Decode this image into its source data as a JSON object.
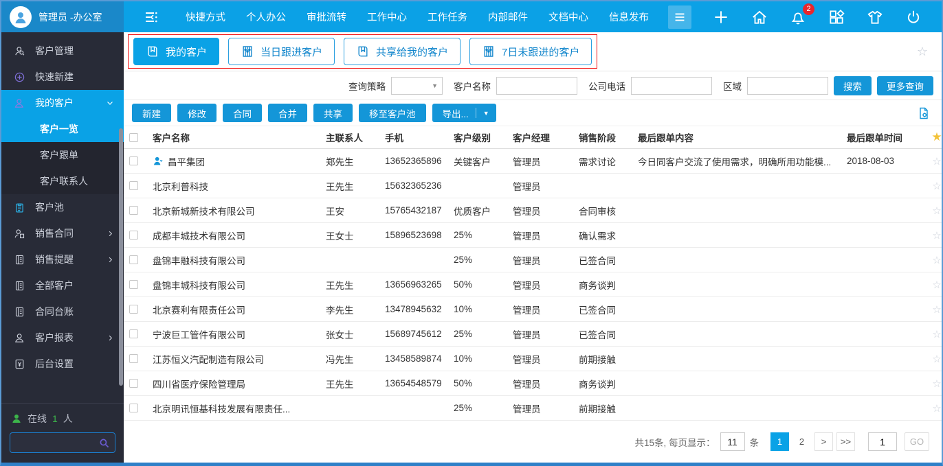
{
  "header": {
    "user": "管理员 -办公室",
    "nav": [
      "快捷方式",
      "个人办公",
      "审批流转",
      "工作中心",
      "工作任务",
      "内部邮件",
      "文档中心",
      "信息发布"
    ],
    "notification_count": "2",
    "right_icons": [
      "plus-icon",
      "home-icon",
      "bell-icon",
      "apps-icon",
      "shirt-icon",
      "power-icon"
    ]
  },
  "sidebar": {
    "items": [
      {
        "label": "客户管理",
        "icon": "customer-icon",
        "type": "item"
      },
      {
        "label": "快速新建",
        "icon": "plus-circle-icon",
        "type": "item"
      },
      {
        "label": "我的客户",
        "icon": "my-customer-icon",
        "type": "item",
        "active": true,
        "expanded": true
      },
      {
        "label": "客户一览",
        "type": "sub",
        "active": true
      },
      {
        "label": "客户跟单",
        "type": "sub"
      },
      {
        "label": "客户联系人",
        "type": "sub"
      },
      {
        "label": "客户池",
        "icon": "clipboard-icon",
        "type": "item"
      },
      {
        "label": "销售合同",
        "icon": "contract-icon",
        "type": "item",
        "arrow": true
      },
      {
        "label": "销售提醒",
        "icon": "phonebook-icon",
        "type": "item",
        "arrow": true
      },
      {
        "label": "全部客户",
        "icon": "phonebook-icon",
        "type": "item"
      },
      {
        "label": "合同台账",
        "icon": "phonebook-icon",
        "type": "item"
      },
      {
        "label": "客户报表",
        "icon": "person-icon",
        "type": "item",
        "arrow": true
      },
      {
        "label": "后台设置",
        "icon": "settings-book-icon",
        "type": "item"
      }
    ],
    "online_label": "在线",
    "online_count": "1",
    "online_unit": "人"
  },
  "tabs": [
    {
      "label": "我的客户",
      "icon": "book-icon",
      "active": true
    },
    {
      "label": "当日跟进客户",
      "icon": "abacus-icon",
      "active": false
    },
    {
      "label": "共享给我的客户",
      "icon": "book-icon",
      "active": false
    },
    {
      "label": "7日未跟进的客户",
      "icon": "abacus-icon",
      "active": false
    }
  ],
  "filters": {
    "strategy_label": "查询策略",
    "name_label": "客户名称",
    "phone_label": "公司电话",
    "region_label": "区域",
    "search_button": "搜索",
    "more_button": "更多查询"
  },
  "actions": [
    "新建",
    "修改",
    "合同",
    "合并",
    "共享",
    "移至客户池"
  ],
  "export_button": "导出...",
  "table": {
    "columns": [
      "客户名称",
      "主联系人",
      "手机",
      "客户级别",
      "客户经理",
      "销售阶段",
      "最后跟单内容",
      "最后跟单时间"
    ],
    "rows": [
      {
        "name": "昌平集团",
        "flag": true,
        "contact": "郑先生",
        "phone": "13652365896",
        "level": "关键客户",
        "manager": "管理员",
        "stage": "需求讨论",
        "note": "今日同客户交流了使用需求，明确所用功能模...",
        "date": "2018-08-03"
      },
      {
        "name": "北京利普科技",
        "flag": false,
        "contact": "王先生",
        "phone": "15632365236",
        "level": "",
        "manager": "管理员",
        "stage": "",
        "note": "",
        "date": ""
      },
      {
        "name": "北京新城新技术有限公司",
        "flag": false,
        "contact": "王安",
        "phone": "15765432187",
        "level": "优质客户",
        "manager": "管理员",
        "stage": "合同审核",
        "note": "",
        "date": ""
      },
      {
        "name": "成都丰城技术有限公司",
        "flag": false,
        "contact": "王女士",
        "phone": "15896523698",
        "level": "25%",
        "manager": "管理员",
        "stage": "确认需求",
        "note": "",
        "date": ""
      },
      {
        "name": "盘锦丰融科技有限公司",
        "flag": false,
        "contact": "",
        "phone": "",
        "level": "25%",
        "manager": "管理员",
        "stage": "已签合同",
        "note": "",
        "date": ""
      },
      {
        "name": "盘锦丰城科技有限公司",
        "flag": false,
        "contact": "王先生",
        "phone": "13656963265",
        "level": "50%",
        "manager": "管理员",
        "stage": "商务谈判",
        "note": "",
        "date": ""
      },
      {
        "name": "北京赛利有限责任公司",
        "flag": false,
        "contact": "李先生",
        "phone": "13478945632",
        "level": "10%",
        "manager": "管理员",
        "stage": "已签合同",
        "note": "",
        "date": ""
      },
      {
        "name": "宁波巨工管件有限公司",
        "flag": false,
        "contact": "张女士",
        "phone": "15689745612",
        "level": "25%",
        "manager": "管理员",
        "stage": "已签合同",
        "note": "",
        "date": ""
      },
      {
        "name": "江苏恒义汽配制造有限公司",
        "flag": false,
        "contact": "冯先生",
        "phone": "13458589874",
        "level": "10%",
        "manager": "管理员",
        "stage": "前期接触",
        "note": "",
        "date": ""
      },
      {
        "name": "四川省医疗保险管理局",
        "flag": false,
        "contact": "王先生",
        "phone": "13654548579",
        "level": "50%",
        "manager": "管理员",
        "stage": "商务谈判",
        "note": "",
        "date": ""
      },
      {
        "name": "北京明讯恒基科技发展有限责任...",
        "flag": false,
        "contact": "",
        "phone": "",
        "level": "25%",
        "manager": "管理员",
        "stage": "前期接触",
        "note": "",
        "date": ""
      }
    ]
  },
  "pagination": {
    "total_text": "共15条, 每页显示：",
    "page_size": "11",
    "unit": "条",
    "pages": [
      "1",
      "2"
    ],
    "active_page": "1",
    "next": ">",
    "last": ">>",
    "goto_value": "1",
    "go_label": "GO"
  },
  "colors": {
    "header_blue": "#0ba1e6",
    "header_left_blue": "#1a88c9",
    "sidebar_bg": "#282b37",
    "accent": "#0aa2e6",
    "button_blue": "#1496d8",
    "badge_red": "#e8262d",
    "online_green": "#3cb54a",
    "tab_outline_red": "#f10c0c",
    "star_gold": "#f3c238"
  }
}
